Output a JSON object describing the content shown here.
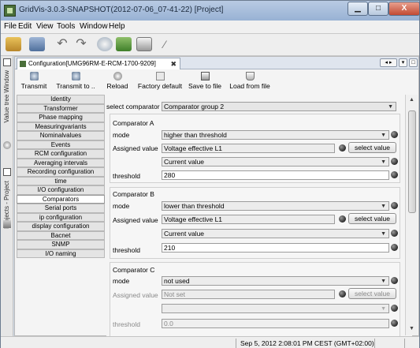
{
  "window": {
    "title": "GridVis-3.0.3-SNAPSHOT(2012-07-06_07-41-22) [Project]",
    "min_glyph": "▁",
    "max_glyph": "□",
    "close_glyph": "X"
  },
  "menu": [
    "File",
    "Edit",
    "View",
    "Tools",
    "Window",
    "Help"
  ],
  "side_rails": {
    "value_tree": "Value tree Window",
    "projects": "Projects - Project"
  },
  "tab": {
    "label": "Configuration[UMG96RM-E-RCM-1700-9209]",
    "close_glyph": "✖"
  },
  "editor_toolbar": {
    "transmit": "Transmit",
    "transmit_to": "Transmit to ..",
    "reload": "Reload",
    "factory_default": "Factory default",
    "save_to_file": "Save to file",
    "load_from_file": "Load from file"
  },
  "nav": [
    "Identity",
    "Transformer",
    "Phase mapping",
    "Measuringvariants",
    "Nominalvalues",
    "Events",
    "RCM configuration",
    "Averaging intervals",
    "Recording configuration",
    "time",
    "I/O configuration",
    "Comparators",
    "Serial ports",
    "ip configuration",
    "display configuration",
    "Bacnet",
    "SNMP",
    "I/O naming"
  ],
  "selected_nav": "Comparators",
  "comparator_select": {
    "label": "select comparator",
    "value": "Comparator group 2"
  },
  "labels": {
    "mode": "mode",
    "assigned_value": "Assigned value",
    "threshold": "threshold",
    "select_value_button": "select value"
  },
  "comparators": [
    {
      "title": "Comparator A",
      "mode": "higher than threshold",
      "assigned_value": "Voltage effective L1",
      "value_type": "Current value",
      "threshold": "280",
      "enabled": true
    },
    {
      "title": "Comparator B",
      "mode": "lower than threshold",
      "assigned_value": "Voltage effective L1",
      "value_type": "Current value",
      "threshold": "210",
      "enabled": true
    },
    {
      "title": "Comparator C",
      "mode": "not used",
      "assigned_value": "Not set",
      "value_type": "",
      "threshold": "0.0",
      "enabled": false
    }
  ],
  "status": {
    "timestamp": "Sep 5, 2012 2:08:01 PM CEST (GMT+02:00)"
  },
  "colors": {
    "titlebar": "#98b2d4",
    "close_button": "#c24a33",
    "panel_bg": "#f4f4f4"
  }
}
